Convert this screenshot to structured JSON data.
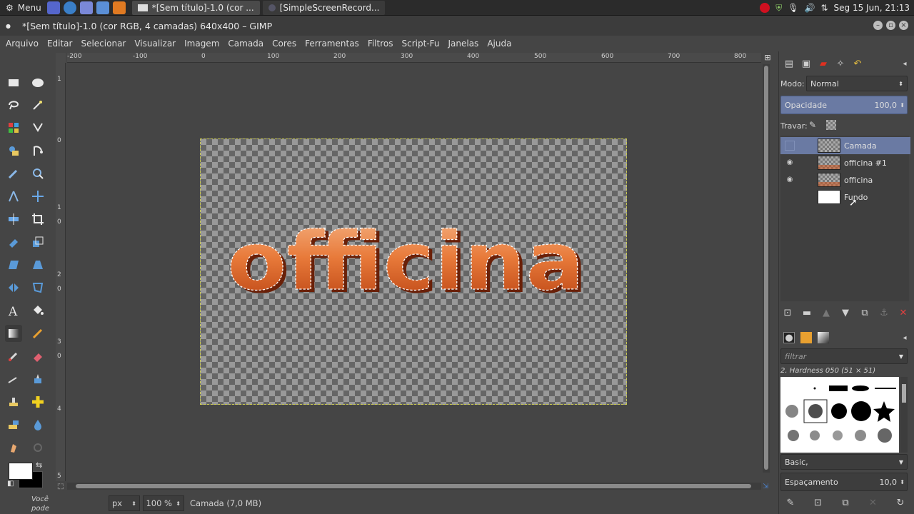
{
  "system_panel": {
    "menu_label": "Menu",
    "tasks": [
      "*[Sem título]-1.0 (cor ...",
      "[SimpleScreenRecord..."
    ],
    "clock": "Seg 15 Jun, 21:13"
  },
  "window": {
    "title": "*[Sem título]-1.0 (cor RGB, 4 camadas) 640x400 – GIMP"
  },
  "menubar": [
    "Arquivo",
    "Editar",
    "Selecionar",
    "Visualizar",
    "Imagem",
    "Camada",
    "Cores",
    "Ferramentas",
    "Filtros",
    "Script-Fu",
    "Janelas",
    "Ajuda"
  ],
  "rulers": {
    "horizontal": [
      "-200",
      "-100",
      "0",
      "100",
      "200",
      "300",
      "400",
      "500",
      "600",
      "700",
      "800"
    ],
    "vertical": [
      "1",
      "0",
      "1",
      "0",
      "2",
      "0",
      "3",
      "0",
      "4",
      "5"
    ]
  },
  "canvas": {
    "text": "officina",
    "colors": {
      "text_top": "#f0a060",
      "text_bottom": "#c04810",
      "shadow": "#6a2008",
      "selection": "#c8c850"
    }
  },
  "statusbar": {
    "unit": "px",
    "zoom": "100 %",
    "info": "Camada (7,0 MB)"
  },
  "toolbox": {
    "hint_line1": "Você",
    "hint_line2": "pode"
  },
  "layers_panel": {
    "mode_label": "Modo:",
    "mode_value": "Normal",
    "opacity_label": "Opacidade",
    "opacity_value": "100,0",
    "lock_label": "Travar:",
    "layers": [
      {
        "name": "Camada",
        "visible": false,
        "selected": true,
        "thumb": "checker"
      },
      {
        "name": "officina #1",
        "visible": true,
        "selected": false,
        "thumb": "checker-orange"
      },
      {
        "name": "officina",
        "visible": true,
        "selected": false,
        "thumb": "checker-orange"
      },
      {
        "name": "Fundo",
        "visible": false,
        "selected": false,
        "thumb": "white"
      }
    ]
  },
  "brushes_panel": {
    "filter_placeholder": "filtrar",
    "selected_brush": "2. Hardness 050 (51 × 51)",
    "preset": "Basic,",
    "spacing_label": "Espaçamento",
    "spacing_value": "10,0"
  },
  "accent_color": "#6a7aa3"
}
